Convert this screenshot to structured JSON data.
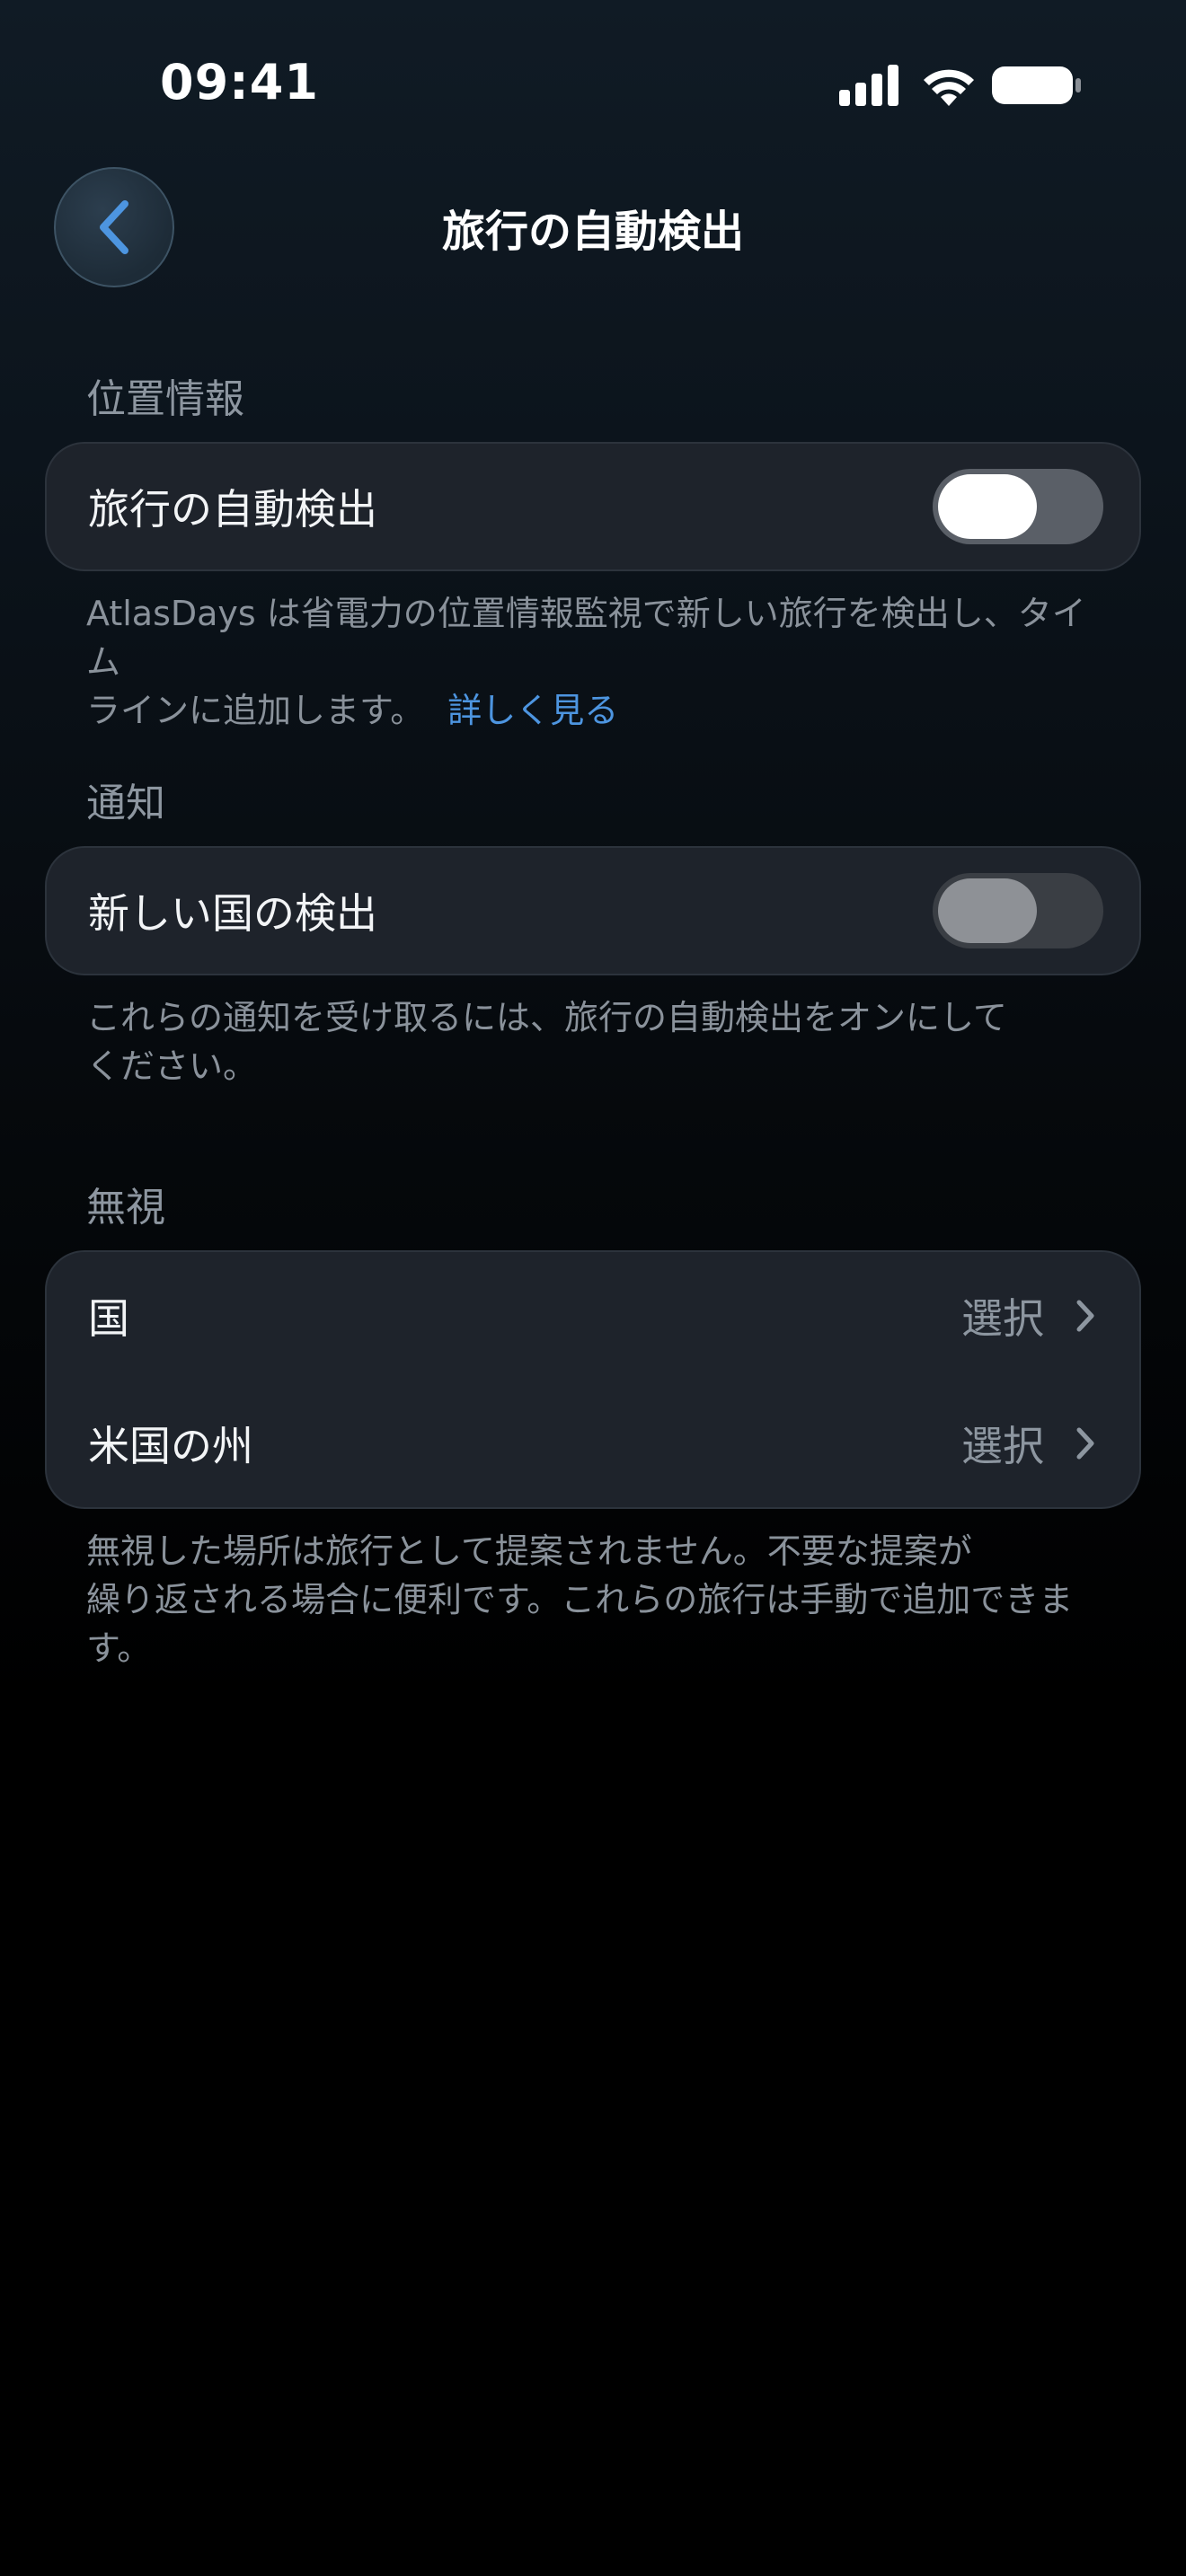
{
  "status_bar": {
    "time": "09:41"
  },
  "nav": {
    "title": "旅行の自動検出"
  },
  "sections": {
    "location": {
      "header": "位置情報",
      "row_label": "旅行の自動検出",
      "toggle_on": true,
      "footnote_line1": "AtlasDays は省電力の位置情報監視で新しい旅行を検出し、タイム",
      "footnote_line2": "ラインに追加します。",
      "footnote_link": "詳しく見る"
    },
    "notifications": {
      "header": "通知",
      "row_label": "新しい国の検出",
      "toggle_on": false,
      "footnote_line1": "これらの通知を受け取るには、旅行の自動検出をオンにして",
      "footnote_line2": "ください。"
    },
    "ignore": {
      "header": "無視",
      "rows": [
        {
          "label": "国",
          "value": "選択"
        },
        {
          "label": "米国の州",
          "value": "選択"
        }
      ],
      "footnote_line1": "無視した場所は旅行として提案されません。不要な提案が",
      "footnote_line2": "繰り返される場合に便利です。これらの旅行は手動で追加できます。"
    }
  },
  "colors": {
    "accent": "#4d95e0",
    "card": "#1e232b",
    "secondary_text": "#8d96a0"
  }
}
